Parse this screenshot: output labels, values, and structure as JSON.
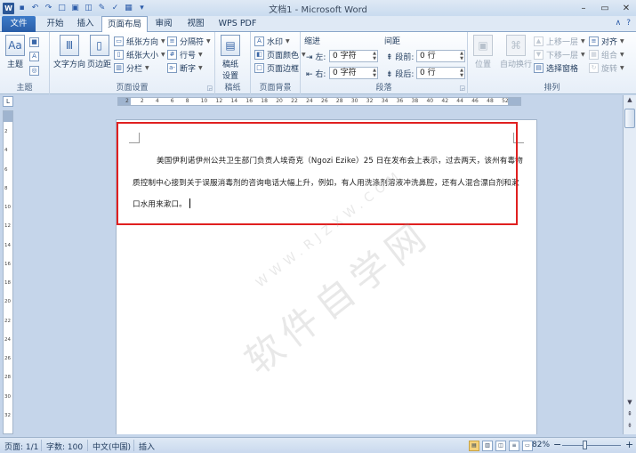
{
  "window": {
    "title": "文档1 - Microsoft Word",
    "minimize": "–",
    "restore": "▭",
    "close": "✕"
  },
  "qat": {
    "undo_icon": "↶",
    "redo_icon": "↷",
    "save_icon": "▪",
    "app_icon": "W"
  },
  "tabs": [
    {
      "label": "文件"
    },
    {
      "label": "开始"
    },
    {
      "label": "插入"
    },
    {
      "label": "页面布局"
    },
    {
      "label": "审阅"
    },
    {
      "label": "视图"
    },
    {
      "label": "WPS PDF"
    }
  ],
  "active_tab": "页面布局",
  "tab_right": {
    "expand": "∧",
    "help": "?"
  },
  "ribbon": {
    "theme_group": {
      "label": "主题",
      "theme_btn": "主题"
    },
    "page_setup": {
      "label": "页面设置",
      "text_direction": "文字方向",
      "margins": "页边距",
      "orientation": "纸张方向",
      "size": "纸张大小",
      "columns": "分栏",
      "breaks": "分隔符",
      "line_numbers": "行号",
      "hyphenation": "断字"
    },
    "draft": {
      "label": "稿纸",
      "draft_settings_1": "稿纸",
      "draft_settings_2": "设置"
    },
    "page_bg": {
      "label": "页面背景",
      "watermark": "水印",
      "page_color": "页面颜色",
      "page_borders": "页面边框"
    },
    "paragraph": {
      "label": "段落",
      "indent_title": "缩进",
      "spacing_title": "间距",
      "left_label": "左:",
      "left_value": "0 字符",
      "right_label": "右:",
      "right_value": "0 字符",
      "before_label": "段前:",
      "before_value": "0 行",
      "after_label": "段后:",
      "after_value": "0 行"
    },
    "arrange": {
      "label": "排列",
      "position": "位置",
      "wrap_text": "自动换行",
      "bring_forward": "上移一层",
      "send_backward": "下移一层",
      "selection_pane": "选择窗格",
      "align": "对齐",
      "group": "组合",
      "rotate": "旋转"
    }
  },
  "ruler": {
    "ticks": [
      "2",
      "2",
      "4",
      "6",
      "8",
      "10",
      "12",
      "14",
      "16",
      "18",
      "20",
      "22",
      "24",
      "26",
      "28",
      "30",
      "32",
      "34",
      "36",
      "38",
      "40",
      "42",
      "44",
      "46",
      "48",
      "52"
    ],
    "vticks": [
      "2",
      "4",
      "6",
      "8",
      "10",
      "12",
      "14",
      "16",
      "18",
      "20",
      "22",
      "24",
      "26",
      "28",
      "30",
      "32"
    ]
  },
  "document": {
    "paragraph": "美国伊利诺伊州公共卫生部门负责人埃奇克（Ngozi Ezike）25 日在发布会上表示，过去两天，该州有毒物质控制中心接到关于误服消毒剂的咨询电话大幅上升，例如，有人用洗涤剂溶液冲洗鼻腔，还有人混合漂白剂和漱口水用来漱口。"
  },
  "watermark": {
    "main": "软件自学网",
    "sub": "WWW.RJZXW.COM"
  },
  "status": {
    "page": "页面: 1/1",
    "words": "字数: 100",
    "language": "中文(中国)",
    "mode": "插入",
    "zoom": "82%",
    "zoom_minus": "−",
    "zoom_plus": "+"
  }
}
